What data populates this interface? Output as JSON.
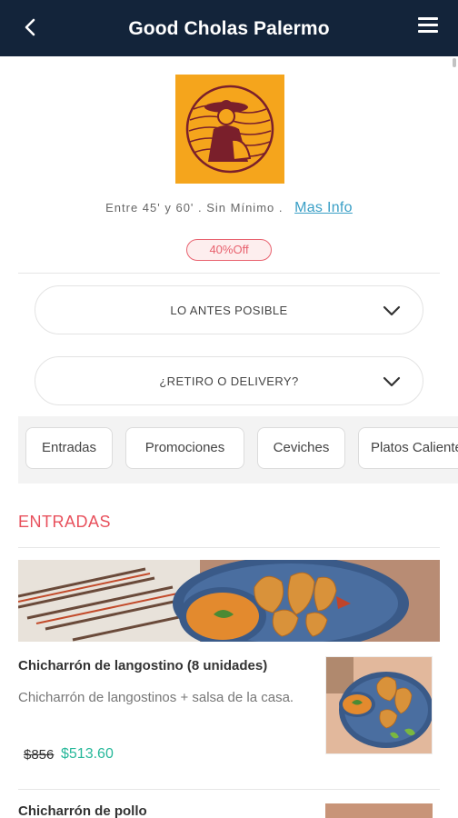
{
  "header": {
    "title": "Good Cholas Palermo",
    "background": "#13243a"
  },
  "store": {
    "delivery_info": "Entre 45' y 60' . Sin Mínimo .",
    "more_info_link": "Mas Info",
    "discount_badge": "40%Off",
    "logo_color": "#f5a51c"
  },
  "selectors": {
    "timing": "LO ANTES POSIBLE",
    "fulfillment": "¿RETIRO O DELIVERY?"
  },
  "categories": [
    {
      "label": "Entradas"
    },
    {
      "label": "Promociones"
    },
    {
      "label": "Ceviches"
    },
    {
      "label": "Platos Calientes"
    }
  ],
  "section": {
    "title": "ENTRADAS",
    "accent": "#e8505c"
  },
  "items": [
    {
      "name": "Chicharrón de langostino (8 unidades)",
      "description": "Chicharrón de langostinos + salsa de la casa.",
      "old_price": "$856",
      "price": "$513.60"
    },
    {
      "name": "Chicharrón de pollo"
    }
  ]
}
